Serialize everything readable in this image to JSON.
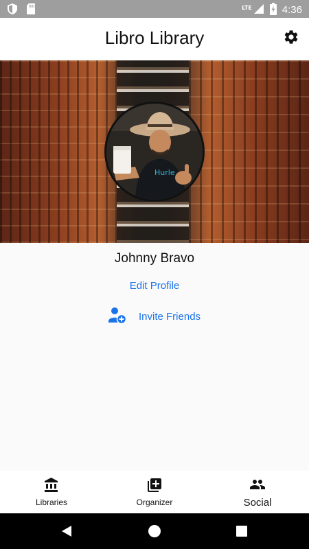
{
  "status_bar": {
    "time": "4:36",
    "network": "LTE",
    "icons": [
      "shield-icon",
      "sd-card-icon",
      "signal-icon",
      "battery-charging-icon"
    ]
  },
  "app_bar": {
    "title": "Libro Library",
    "settings_icon": "gear-icon"
  },
  "profile": {
    "name": "Johnny Bravo",
    "edit_label": "Edit Profile",
    "invite_label": "Invite Friends",
    "invite_icon": "add-person-icon"
  },
  "bottom_nav": {
    "items": [
      {
        "label": "Libraries",
        "icon": "library-icon"
      },
      {
        "label": "Organizer",
        "icon": "add-box-icon"
      },
      {
        "label": "Social",
        "icon": "people-icon"
      }
    ],
    "active": "Social"
  },
  "system_nav": {
    "icons": [
      "back-icon",
      "home-icon",
      "recents-icon"
    ]
  },
  "colors": {
    "accent": "#1a73e8",
    "status_bar": "#9e9e9e",
    "app_bar": "#ffffff",
    "background": "#fafafa"
  }
}
